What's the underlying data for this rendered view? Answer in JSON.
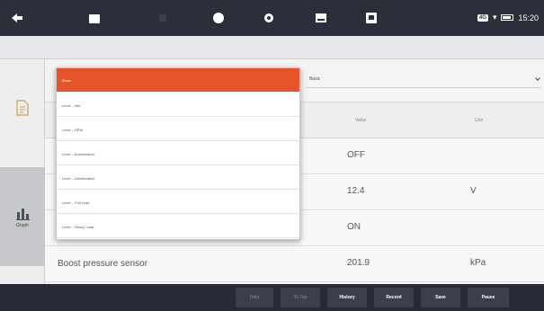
{
  "topbar": {
    "small_line1": "",
    "small_line2": "",
    "status_time": "15:20",
    "status_tag": "4G"
  },
  "breadcrumb": {
    "text": ""
  },
  "leftnav": {
    "graph_label": "Graph"
  },
  "select": {
    "value": "Basic"
  },
  "table": {
    "col_value": "Value",
    "col_unit": "Unit",
    "rows": [
      {
        "name": "",
        "value": "OFF",
        "unit": ""
      },
      {
        "name": "",
        "value": "12.4",
        "unit": "V"
      },
      {
        "name": "",
        "value": "ON",
        "unit": ""
      },
      {
        "name": "Boost pressure sensor",
        "value": "201.9",
        "unit": "kPa"
      }
    ]
  },
  "dropdown": {
    "items": [
      {
        "label": "Basic"
      },
      {
        "label": "Level – Idle"
      },
      {
        "label": "Level – RPM"
      },
      {
        "label": "Level – Acceleration"
      },
      {
        "label": "Level – Deceleration"
      },
      {
        "label": "Level – Full Load"
      },
      {
        "label": "Level – Heavy Load"
      }
    ]
  },
  "bottombar": {
    "left_line1": "",
    "left_line2": "",
    "buttons": {
      "help": "Help",
      "to_top": "To Top",
      "history": "History",
      "record": "Record",
      "save": "Save",
      "pause": "Pause"
    }
  },
  "colors": {
    "accent": "#e8542a",
    "topbar": "#2b2f3a",
    "bottombar": "#262a34"
  }
}
